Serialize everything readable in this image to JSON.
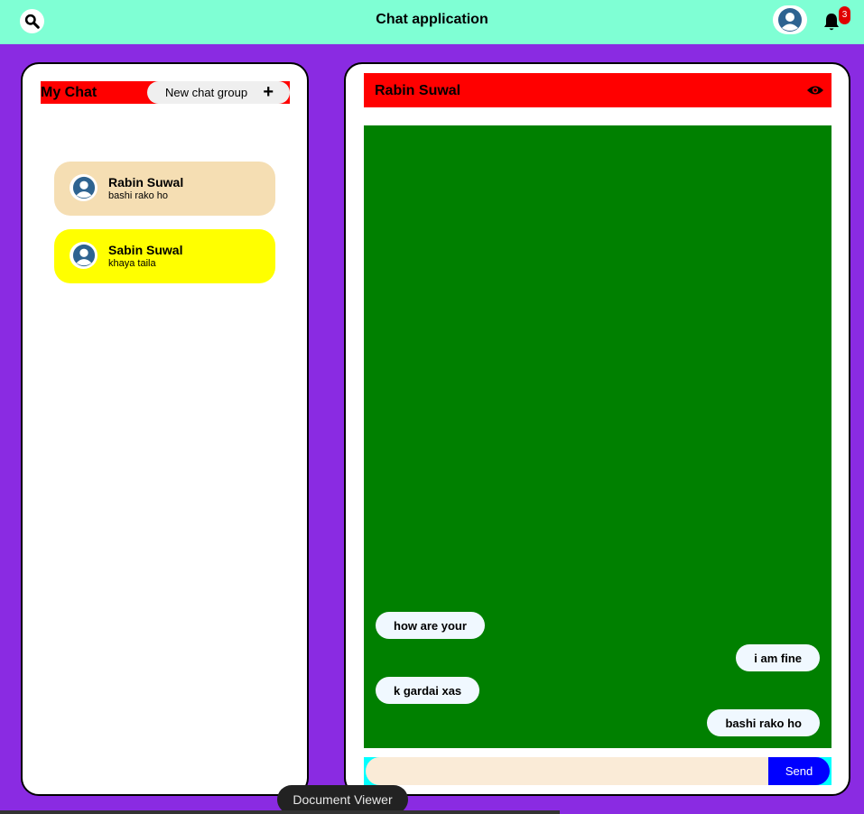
{
  "header": {
    "title": "Chat application",
    "notification_count": "3"
  },
  "sidebar": {
    "title": "My Chat",
    "new_group_label": "New chat group",
    "new_group_icon": "+",
    "chats": [
      {
        "name": "Rabin Suwal",
        "last_message": "bashi rako ho",
        "color": "#f5deb3"
      },
      {
        "name": "Sabin Suwal",
        "last_message": "khaya taila",
        "color": "#ffff00"
      }
    ]
  },
  "chat": {
    "contact_name": "Rabin Suwal",
    "messages": [
      {
        "text": "how are your",
        "side": "left"
      },
      {
        "text": "i am fine",
        "side": "right"
      },
      {
        "text": "k gardai xas",
        "side": "left"
      },
      {
        "text": "bashi rako ho",
        "side": "right"
      }
    ],
    "input_value": "",
    "send_label": "Send"
  },
  "tooltip": "Document Viewer",
  "colors": {
    "background": "#8a2be2",
    "topbar": "#7fffd4",
    "header_red": "#ff0000",
    "messages_bg": "#008000",
    "bubble": "#f0f8ff",
    "send": "#0000ff"
  }
}
